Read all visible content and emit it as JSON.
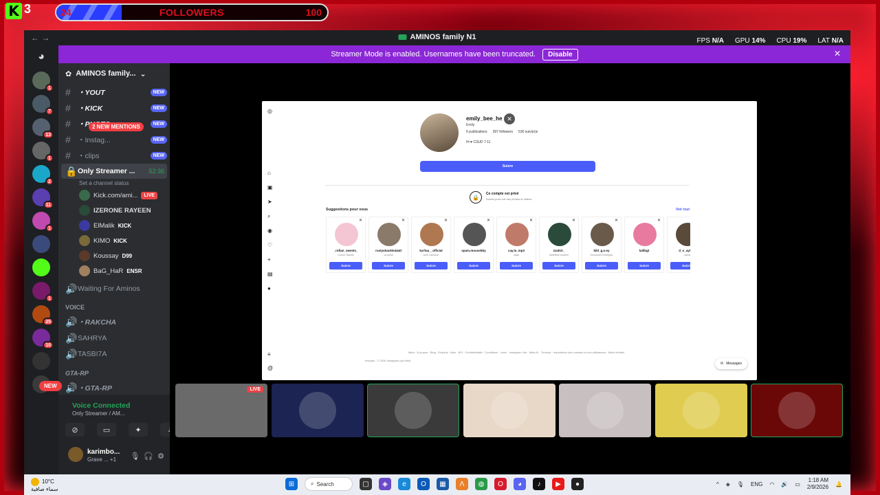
{
  "overlay": {
    "kick_count": "3",
    "followers_current": "24",
    "followers_label": "FOLLOWERS",
    "followers_goal": "100",
    "followers_progress": 0.24
  },
  "window": {
    "title": "AMINOS family N1",
    "stats": {
      "fps_label": "FPS",
      "fps": "N/A",
      "gpu_label": "GPU",
      "gpu": "14%",
      "cpu_label": "CPU",
      "cpu": "19%",
      "lat_label": "LAT",
      "lat": "N/A"
    }
  },
  "banner": {
    "text": "Streamer Mode is enabled. Usernames have been truncated.",
    "disable_label": "Disable"
  },
  "servers": [
    {
      "badge": "1",
      "color": "#5a6a5a"
    },
    {
      "badge": "7",
      "color": "#4a5a66"
    },
    {
      "badge": "13",
      "color": "#556070"
    },
    {
      "badge": "1",
      "color": "#666666"
    },
    {
      "badge": "2",
      "color": "#1aa7c9"
    },
    {
      "badge": "11",
      "color": "#5a3fb0"
    },
    {
      "badge": "1",
      "color": "#c04ab0"
    },
    {
      "badge": "",
      "color": "#3a4a7a"
    },
    {
      "badge": "",
      "color": "#53fc18"
    },
    {
      "badge": "1",
      "color": "#7a1a6a"
    },
    {
      "badge": "25",
      "color": "#b04a10"
    },
    {
      "badge": "10",
      "color": "#7a2a9a"
    },
    {
      "badge": "",
      "color": "#333333"
    },
    {
      "badge": "",
      "color": "#3a3a3a"
    }
  ],
  "guild": {
    "name": "AMINOS family..."
  },
  "mentions": "2 NEW MENTIONS",
  "channels": [
    {
      "name": "・YOUT",
      "new": "NEW"
    },
    {
      "name": "・KICK",
      "new": "NEW"
    },
    {
      "name": "・PHOTO",
      "new": "NEW"
    },
    {
      "name": "・Instag...",
      "new": "NEW"
    },
    {
      "name": "・clips",
      "new": "NEW"
    }
  ],
  "voice_channel": {
    "name": "Only Streamer ...",
    "timer": "52:36",
    "status": "Set a channel status"
  },
  "voice_users": [
    {
      "name": "Kick.com/ami...",
      "tag": "LIVE"
    },
    {
      "name": "IZERONE RAYEEN",
      "tag": ""
    },
    {
      "name": "ElMalik",
      "tag": "KICK"
    },
    {
      "name": "KIMO",
      "tag": "KICK"
    },
    {
      "name": "Koussay",
      "tag": "D99"
    },
    {
      "name": "BaG_HaR",
      "tag": "ENSR"
    }
  ],
  "other_channels": {
    "waiting": "Waiting For Aminos",
    "voice_cat": "VOICE",
    "rakcha": "・RAKCHA",
    "sahrya": "SAHRYA",
    "tasbi": "TASBI7A",
    "gta_cat": "GTA-RP",
    "gta": "・GTA-RP",
    "new_label": "NEW"
  },
  "voice_panel": {
    "status": "Voice Connected",
    "channel": "Only Streamer / AM..."
  },
  "user": {
    "name": "karimbo...",
    "status": "Grave ... +1"
  },
  "instagram": {
    "username": "emily_bee_he",
    "realname": "Emily",
    "posts": "6 publications",
    "followers": "397 followers",
    "following": "530 suivi(e)s",
    "bio": "Hi ♥ CSUD 7:11",
    "follow_btn": "Suivre",
    "private_title": "Ce compte est privé",
    "private_sub": "Suivez pour voir ses photos et vidéos.",
    "suggestions_title": "Suggestions pour vous",
    "see_all": "Voir tout",
    "suggestions": [
      {
        "name": "_rofian_sweets_",
        "sub": "Lorka's Sweets",
        "color": "#f4c5d2"
      },
      {
        "name": "rustyshackle444d",
        "sub": "ca.prime",
        "color": "#8a7a6a"
      },
      {
        "name": "ka7laa__official",
        "sub": "Amir Lahmouri",
        "color": "#b07850"
      },
      {
        "name": "spam.mousebby",
        "sub": "",
        "color": "#555555"
      },
      {
        "name": "cay.la_mp3",
        "sub": "cayla",
        "color": "#c07a6a"
      },
      {
        "name": "zzahiri_",
        "sub": "abdelillah.ezzahiri",
        "color": "#2a4a3a"
      },
      {
        "name": "kikl_g.o.ey",
        "sub": "Enmanuel Rodriguez",
        "color": "#6a5a4a"
      },
      {
        "name": "lailibgt",
        "sub": "",
        "color": "#e87aa0"
      },
      {
        "name": "d_o_ayhan",
        "sub": "...Ayhan",
        "color": "#5a4a3a"
      }
    ],
    "suggest_btn": "Suivre",
    "footer": "Meta · À propos · Blog · Emplois · Aide · API · Confidentialité · Conditions · Lieux · Instagram Lite · Meta AI · Threads · Importation des contacts et non-utilisateurs · Meta Verified",
    "copyright": "français · © 2026 Instagram par Meta",
    "messages": "Messages"
  },
  "thumbs": [
    {
      "color": "#6a6a6a",
      "live": "LIVE"
    },
    {
      "color": "#1b2452",
      "live": ""
    },
    {
      "color": "#3a3a3a",
      "live": ""
    },
    {
      "color": "#e8d8c8",
      "live": ""
    },
    {
      "color": "#c8c0c0",
      "live": ""
    },
    {
      "color": "#e0cc50",
      "live": ""
    },
    {
      "color": "#6a0808",
      "live": ""
    }
  ],
  "taskbar": {
    "temp": "10°C",
    "weather": "سماء صافية",
    "search": "Search",
    "lang": "ENG",
    "time": "1:18 AM",
    "date": "2/9/2026"
  }
}
